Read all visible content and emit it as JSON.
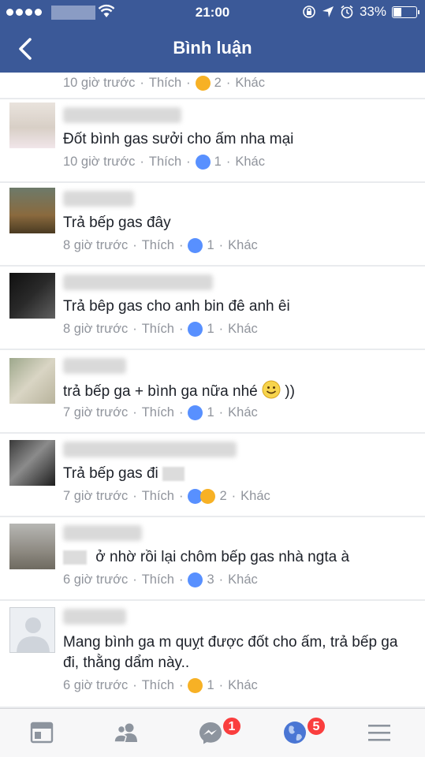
{
  "status": {
    "time": "21:00",
    "battery": "33%",
    "battery_level": 0.33
  },
  "header": {
    "title": "Bình luận"
  },
  "comments": [
    {
      "body": "",
      "time": "10 giờ trước",
      "like": "Thích",
      "reactions": [
        "haha"
      ],
      "count": "2",
      "more": "Khác"
    },
    {
      "body": "Đốt bình gas sưởi cho ấm nha mại",
      "time": "10 giờ trước",
      "like": "Thích",
      "reactions": [
        "like"
      ],
      "count": "1",
      "more": "Khác"
    },
    {
      "body": "Trả bếp gas đây",
      "time": "8 giờ trước",
      "like": "Thích",
      "reactions": [
        "like"
      ],
      "count": "1",
      "more": "Khác"
    },
    {
      "body": "Trả bêp gas cho anh bin đê anh êi",
      "time": "8 giờ trước",
      "like": "Thích",
      "reactions": [
        "like"
      ],
      "count": "1",
      "more": "Khác"
    },
    {
      "body": "trả bếp ga + bình ga nữa nhé",
      "body_suffix": "))",
      "time": "7 giờ trước",
      "like": "Thích",
      "reactions": [
        "like"
      ],
      "count": "1",
      "more": "Khác"
    },
    {
      "body": "Trả bếp gas đi",
      "time": "7 giờ trước",
      "like": "Thích",
      "reactions": [
        "like",
        "haha"
      ],
      "count": "2",
      "more": "Khác"
    },
    {
      "body": "ở nhờ rồi lại chôm bếp gas nhà ngta à",
      "time": "6 giờ trước",
      "like": "Thích",
      "reactions": [
        "like"
      ],
      "count": "3",
      "more": "Khác"
    },
    {
      "body": "Mang bình ga m quỵt được đốt cho ấm, trả bếp ga đi, thằng dẩm này..",
      "time": "6 giờ trước",
      "like": "Thích",
      "reactions": [
        "haha"
      ],
      "count": "1",
      "more": "Khác"
    }
  ],
  "separator": "·",
  "tabbar": {
    "messenger_badge": "1",
    "notifications_badge": "5"
  },
  "colors": {
    "brand": "#3b5998",
    "like": "#5890ff",
    "haha": "#f7b125",
    "badge": "#fa3e3e"
  }
}
